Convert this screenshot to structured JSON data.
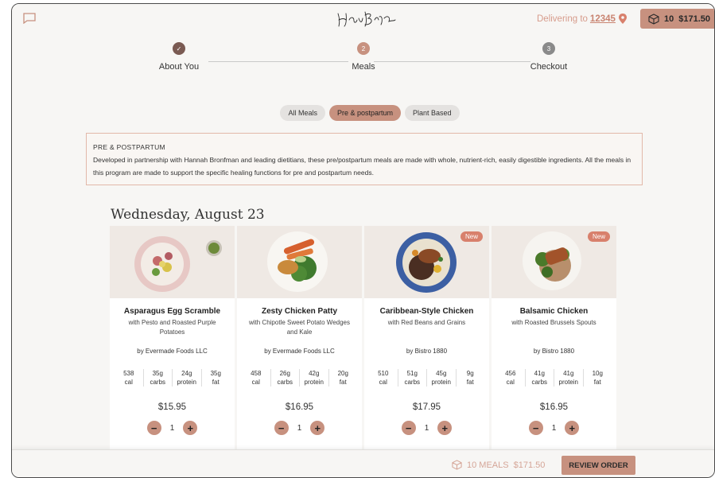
{
  "header": {
    "delivering_label": "Delivering to",
    "zip": "12345",
    "cart_count": "10",
    "cart_total": "$171.50"
  },
  "stepper": {
    "steps": [
      {
        "label": "About You",
        "state": "done",
        "marker": "✓"
      },
      {
        "label": "Meals",
        "state": "current",
        "marker": "2"
      },
      {
        "label": "Checkout",
        "state": "upcoming",
        "marker": "3"
      }
    ]
  },
  "filters": {
    "items": [
      "All Meals",
      "Pre & postpartum",
      "Plant Based"
    ],
    "active": "Pre & postpartum"
  },
  "info": {
    "title": "PRE & POSTPARTUM",
    "description": "Developed in partnership with Hannah Bronfman and leading dietitians, these pre/postpartum meals are made with whole, nutrient-rich, easily digestible ingredients. All the meals in this program are made to support the specific healing functions for pre and postpartum needs."
  },
  "day_title": "Wednesday, August 23",
  "meals": [
    {
      "name": "Asparagus Egg Scramble",
      "subtitle": "with Pesto and Roasted Purple Potatoes",
      "vendor": "by Evermade Foods LLC",
      "badge": "",
      "nutrition": [
        {
          "value": "538",
          "unit": "cal"
        },
        {
          "value": "35g",
          "unit": "carbs"
        },
        {
          "value": "24g",
          "unit": "protein"
        },
        {
          "value": "35g",
          "unit": "fat"
        }
      ],
      "price": "$15.95",
      "qty": "1"
    },
    {
      "name": "Zesty Chicken Patty",
      "subtitle": "with Chipotle Sweet Potato Wedges and Kale",
      "vendor": "by Evermade Foods LLC",
      "badge": "",
      "nutrition": [
        {
          "value": "458",
          "unit": "cal"
        },
        {
          "value": "26g",
          "unit": "carbs"
        },
        {
          "value": "42g",
          "unit": "protein"
        },
        {
          "value": "20g",
          "unit": "fat"
        }
      ],
      "price": "$16.95",
      "qty": "1"
    },
    {
      "name": "Caribbean-Style Chicken",
      "subtitle": "with Red Beans and Grains",
      "vendor": "by Bistro 1880",
      "badge": "New",
      "nutrition": [
        {
          "value": "510",
          "unit": "cal"
        },
        {
          "value": "51g",
          "unit": "carbs"
        },
        {
          "value": "45g",
          "unit": "protein"
        },
        {
          "value": "9g",
          "unit": "fat"
        }
      ],
      "price": "$17.95",
      "qty": "1"
    },
    {
      "name": "Balsamic Chicken",
      "subtitle": "with Roasted Brussels Spouts",
      "vendor": "by Bistro 1880",
      "badge": "New",
      "nutrition": [
        {
          "value": "456",
          "unit": "cal"
        },
        {
          "value": "41g",
          "unit": "carbs"
        },
        {
          "value": "41g",
          "unit": "protein"
        },
        {
          "value": "10g",
          "unit": "fat"
        }
      ],
      "price": "$16.95",
      "qty": "1"
    }
  ],
  "footer": {
    "meals_summary": "10 MEALS",
    "total": "$171.50",
    "review_label": "REVIEW ORDER"
  },
  "colors": {
    "accent": "#c7917f",
    "badge": "#d8806c",
    "step_done": "#7a5a52",
    "step_current": "#c7917f",
    "step_upcoming": "#8a8a8a"
  },
  "icons": {
    "chat": "chat-icon",
    "pin": "location-pin-icon",
    "cart": "box-icon",
    "minus": "minus-icon",
    "plus": "plus-icon"
  }
}
